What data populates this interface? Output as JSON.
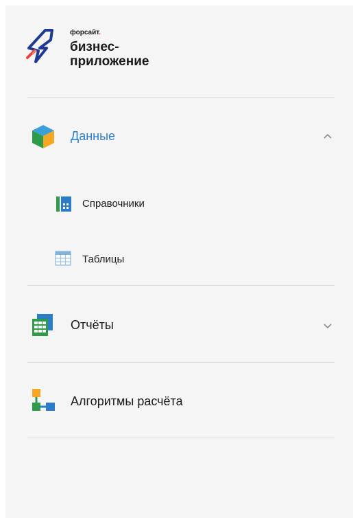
{
  "logo": {
    "brand_small": "форсайт",
    "brand_dot": ".",
    "line1": "бизнес-",
    "line2": "приложение"
  },
  "nav": {
    "data_section": {
      "label": "Данные",
      "icon": "cube-icon",
      "expanded": true
    },
    "sub_items": [
      {
        "label": "Справочники",
        "icon": "directory-book-icon"
      },
      {
        "label": "Таблицы",
        "icon": "table-icon"
      }
    ],
    "reports_section": {
      "label": "Отчёты",
      "icon": "report-icon",
      "expanded": false
    },
    "algorithms_section": {
      "label": "Алгоритмы расчёта",
      "icon": "algorithm-flow-icon"
    }
  },
  "colors": {
    "accent": "#2b7dc9",
    "panel_bg": "#f5f5f5",
    "divider": "#d9d9d9"
  }
}
